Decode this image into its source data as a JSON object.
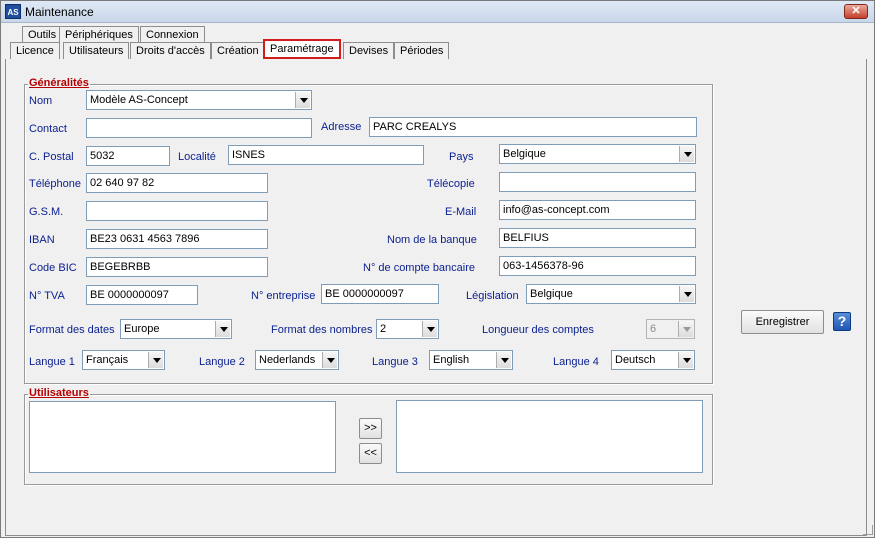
{
  "window": {
    "title": "Maintenance",
    "icon_text": "AS",
    "close_glyph": "✕"
  },
  "tabs_top": [
    "Outils",
    "Périphériques",
    "Connexion"
  ],
  "tabs_bottom": [
    "Licence",
    "Utilisateurs",
    "Droits d'accès",
    "Création",
    "Paramétrage",
    "Devises",
    "Périodes"
  ],
  "active_tab": "Paramétrage",
  "generalites": {
    "title": "Généralités",
    "nom": {
      "label": "Nom",
      "value": "Modèle AS-Concept"
    },
    "contact": {
      "label": "Contact",
      "value": ""
    },
    "adresse": {
      "label": "Adresse",
      "value": "PARC CREALYS"
    },
    "code_postal": {
      "label": "C. Postal",
      "value": "5032"
    },
    "localite": {
      "label": "Localité",
      "value": "ISNES"
    },
    "pays": {
      "label": "Pays",
      "value": "Belgique"
    },
    "telephone": {
      "label": "Téléphone",
      "value": "02 640 97 82"
    },
    "telecopie": {
      "label": "Télécopie",
      "value": ""
    },
    "gsm": {
      "label": "G.S.M.",
      "value": ""
    },
    "email": {
      "label": "E-Mail",
      "value": "info@as-concept.com"
    },
    "iban": {
      "label": "IBAN",
      "value": "BE23 0631 4563 7896"
    },
    "nom_banque": {
      "label": "Nom de la banque",
      "value": "BELFIUS"
    },
    "code_bic": {
      "label": "Code BIC",
      "value": "BEGEBRBB"
    },
    "compte_bancaire": {
      "label": "N° de compte bancaire",
      "value": "063-1456378-96"
    },
    "tva": {
      "label": "N°  TVA",
      "value": "BE 0000000097"
    },
    "entreprise": {
      "label": "N° entreprise",
      "value": "BE 0000000097"
    },
    "legislation": {
      "label": "Législation",
      "value": "Belgique"
    },
    "format_dates": {
      "label": "Format des dates",
      "value": "Europe"
    },
    "format_nombres": {
      "label": "Format des nombres",
      "value": "2"
    },
    "longueur_comptes": {
      "label": "Longueur des comptes",
      "value": "6"
    },
    "langue1": {
      "label": "Langue 1",
      "value": "Français"
    },
    "langue2": {
      "label": "Langue 2",
      "value": "Nederlands"
    },
    "langue3": {
      "label": "Langue 3",
      "value": "English"
    },
    "langue4": {
      "label": "Langue 4",
      "value": "Deutsch"
    }
  },
  "utilisateurs": {
    "title": "Utilisateurs",
    "add_label": ">>",
    "remove_label": "<<"
  },
  "actions": {
    "save_label": "Enregistrer",
    "help_label": "?"
  }
}
